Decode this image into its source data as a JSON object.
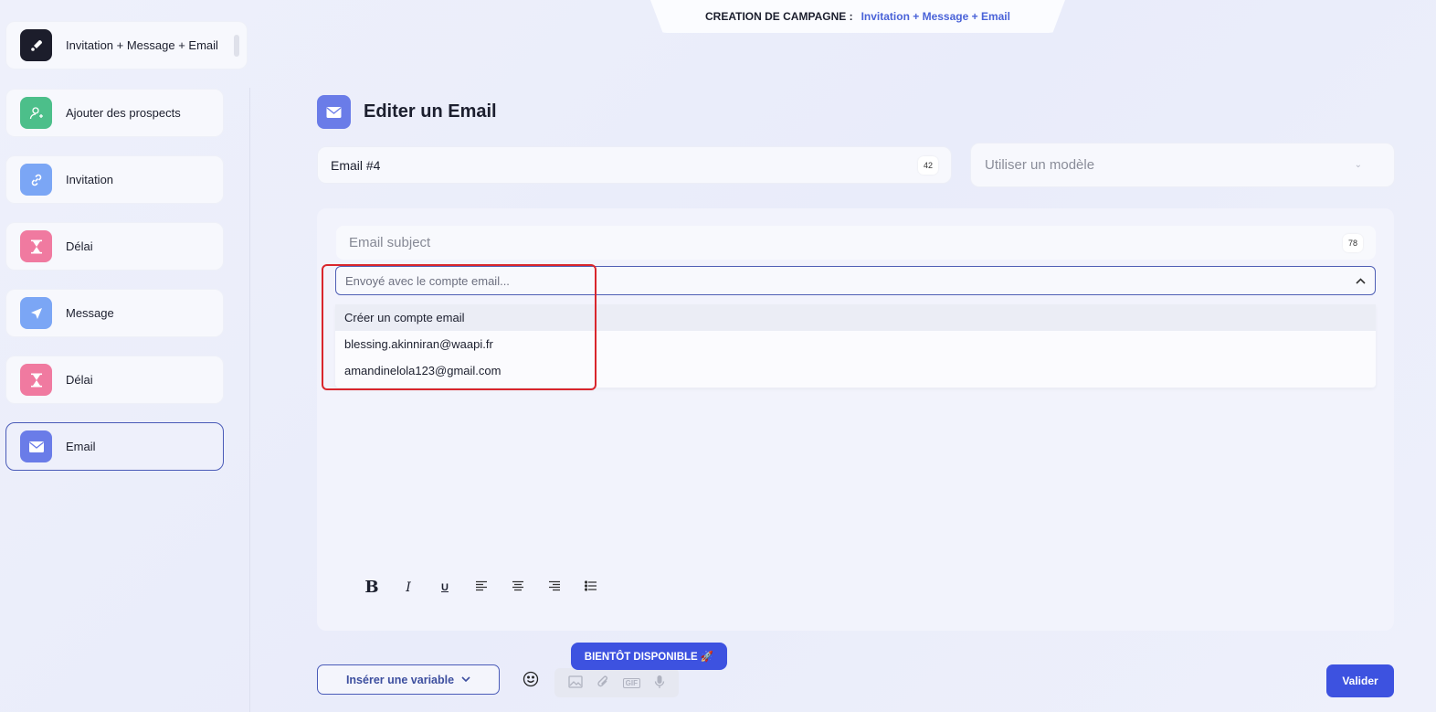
{
  "header": {
    "label": "CREATION DE CAMPAGNE :",
    "campaign": "Invitation + Message + Email"
  },
  "sidebar": {
    "campaign_card": {
      "label": "Invitation + Message + Email",
      "icon": "rocket-icon"
    },
    "steps": [
      {
        "label": "Ajouter des prospects",
        "icon": "add-user-icon",
        "color": "#4cbf8a"
      },
      {
        "label": "Invitation",
        "icon": "link-icon",
        "color": "#7ba6f5"
      },
      {
        "label": "Délai",
        "icon": "hourglass-icon",
        "color": "#f07aa0"
      },
      {
        "label": "Message",
        "icon": "send-icon",
        "color": "#7ba6f5"
      },
      {
        "label": "Délai",
        "icon": "hourglass-icon",
        "color": "#f07aa0"
      },
      {
        "label": "Email",
        "icon": "mail-icon",
        "color": "#6a7ce8",
        "active": true
      }
    ]
  },
  "main": {
    "title": "Editer un Email",
    "name_field": {
      "value": "Email #4",
      "count": "42"
    },
    "model_select": {
      "placeholder": "Utiliser un modèle"
    },
    "subject": {
      "placeholder": "Email subject",
      "count": "78"
    },
    "account_select": {
      "placeholder": "Envoyé avec le compte email...",
      "options": [
        "Créer un compte email",
        "blessing.akinniran@waapi.fr",
        "amandinelola123@gmail.com"
      ]
    },
    "toolbar": {
      "bold": "B",
      "italic": "I",
      "underline": "U"
    }
  },
  "footer": {
    "insert_variable": "Insérer une variable",
    "soon": "BIENTÔT DISPONIBLE 🚀",
    "validate": "Valider"
  },
  "colors": {
    "accent": "#3d52e0",
    "highlight": "#d9262c"
  }
}
